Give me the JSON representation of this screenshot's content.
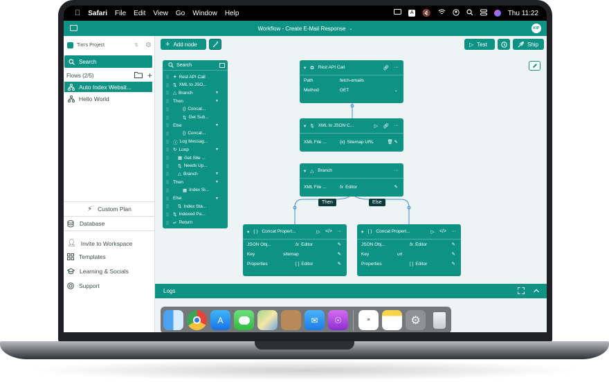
{
  "menubar": {
    "app_name": "Safari",
    "menus": [
      "File",
      "Edit",
      "View",
      "Go",
      "Window",
      "Help"
    ],
    "clock": "Thu 11:22"
  },
  "topbar": {
    "title": "Workflow - Create E-Mail Response",
    "avatar_initials": "KIP"
  },
  "sidebar": {
    "project": "Tim's Project",
    "search_label": "Search",
    "flows_label": "Flows (2/5)",
    "flows": [
      "Auto Index Websit...",
      "Hello World"
    ],
    "custom_plan": "Custom Plan",
    "database": "Database",
    "links": [
      "Invite to Workspace",
      "Templates",
      "Learning & Socials",
      "Support"
    ]
  },
  "toolbar": {
    "add_node": "Add node",
    "test": "Test",
    "ship": "Ship"
  },
  "tree": {
    "search": "Search",
    "items": [
      {
        "label": "Rest API Call",
        "indent": 0,
        "icon": "link-icon"
      },
      {
        "label": "XML to JSO...",
        "indent": 0,
        "icon": "transform-icon"
      },
      {
        "label": "Branch",
        "indent": 0,
        "icon": "branch-icon",
        "caret": true
      },
      {
        "label": "Then",
        "indent": 0,
        "icon": "",
        "caret": true
      },
      {
        "label": "Concat...",
        "indent": 2,
        "icon": "braces-icon"
      },
      {
        "label": "Get Sub...",
        "indent": 2,
        "icon": "transform-icon"
      },
      {
        "label": "Else",
        "indent": 0,
        "icon": "",
        "caret": true
      },
      {
        "label": "Concat...",
        "indent": 2,
        "icon": "braces-icon"
      },
      {
        "label": "Log Messag...",
        "indent": 0,
        "icon": "info-icon"
      },
      {
        "label": "Loop",
        "indent": 0,
        "icon": "loop-icon",
        "caret": true
      },
      {
        "label": "Get Site ...",
        "indent": 1,
        "icon": "table-icon"
      },
      {
        "label": "Needs Up...",
        "indent": 1,
        "icon": "transform-icon"
      },
      {
        "label": "Branch",
        "indent": 1,
        "icon": "branch-icon",
        "caret": true
      },
      {
        "label": "Then",
        "indent": 0,
        "icon": "",
        "caret": true
      },
      {
        "label": "Index Si...",
        "indent": 2,
        "icon": "table-icon"
      },
      {
        "label": "Else",
        "indent": 0,
        "icon": "",
        "caret": true
      },
      {
        "label": "Index Sta...",
        "indent": 1,
        "icon": "transform-icon"
      },
      {
        "label": "Indexed Pa...",
        "indent": 0,
        "icon": "transform-icon"
      },
      {
        "label": "Return",
        "indent": 0,
        "icon": "return-icon"
      }
    ]
  },
  "nodes": {
    "rest": {
      "title": "Rest API Call",
      "path_label": "Path",
      "path_value": "fetch-emails",
      "method_label": "Method",
      "method_value": "GET"
    },
    "xml": {
      "title": "XML to JSON C...",
      "field_label": "XML File ...",
      "field_value": "Sitemap URL"
    },
    "branch": {
      "title": "Branch",
      "field_label": "XML File ...",
      "field_value": "Editor"
    },
    "then_label": "Then",
    "else_label": "Else",
    "concat_left": {
      "title": "Concat Propert...",
      "rows": [
        {
          "label": "JSON Obj...",
          "value": "Editor"
        },
        {
          "label": "Key",
          "value": "sitemap"
        },
        {
          "label": "Properties",
          "value": "Editor"
        }
      ]
    },
    "concat_right": {
      "title": "Concat Propert...",
      "rows": [
        {
          "label": "JSON Obj...",
          "value": "Editor"
        },
        {
          "label": "Key",
          "value": "url"
        },
        {
          "label": "Properties",
          "value": "Editor"
        }
      ]
    }
  },
  "logs": {
    "label": "Logs"
  },
  "colors": {
    "accent": "#0d9284",
    "canvas": "#eef4f3"
  }
}
